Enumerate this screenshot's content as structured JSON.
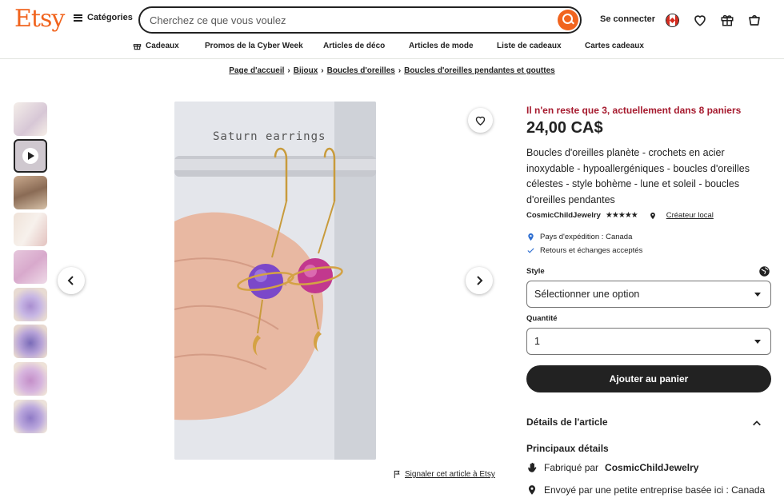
{
  "header": {
    "logo": "Etsy",
    "categories_label": "Catégories",
    "search_placeholder": "Cherchez ce que vous voulez",
    "signin_label": "Se connecter"
  },
  "nav": {
    "items": [
      {
        "label": "Cadeaux"
      },
      {
        "label": "Promos de la Cyber Week"
      },
      {
        "label": "Articles de déco"
      },
      {
        "label": "Articles de mode"
      },
      {
        "label": "Liste de cadeaux"
      },
      {
        "label": "Cartes cadeaux"
      }
    ]
  },
  "breadcrumb": [
    "Page d'accueil",
    "Bijoux",
    "Boucles d'oreilles",
    "Boucles d'oreilles pendantes et gouttes"
  ],
  "gallery": {
    "image_caption": "Saturn earrings",
    "thumbnail_count": 9,
    "active_thumbnail": 2
  },
  "report_label": "Signaler cet article à Etsy",
  "listing": {
    "stock_notice": "Il n'en reste que 3, actuellement dans 8 paniers",
    "price": "24,00 CA$",
    "title": "Boucles d'oreilles planète - crochets en acier inoxydable - hypoallergéniques - boucles d'oreilles célestes - style bohème - lune et soleil - boucles d'oreilles pendantes",
    "shop_name": "CosmicChildJewelry",
    "rating_stars": "★★★★★",
    "rating": 5,
    "local_label": "Créateur local",
    "shipping_country": "Pays d'expédition : Canada",
    "returns": "Retours et échanges acceptés",
    "style_label": "Style",
    "style_value": "Sélectionner une option",
    "quantity_label": "Quantité",
    "quantity_value": "1",
    "add_to_cart": "Ajouter au panier",
    "details_header": "Détails de l'article",
    "main_details_header": "Principaux détails",
    "made_by_prefix": "Fabriqué par",
    "made_by_shop": "CosmicChildJewelry",
    "shipped_from": "Envoyé par une petite entreprise basée ici : Canada"
  },
  "colors": {
    "brand": "#f1641e",
    "stock_red": "#a61a2e",
    "dark": "#222222"
  }
}
